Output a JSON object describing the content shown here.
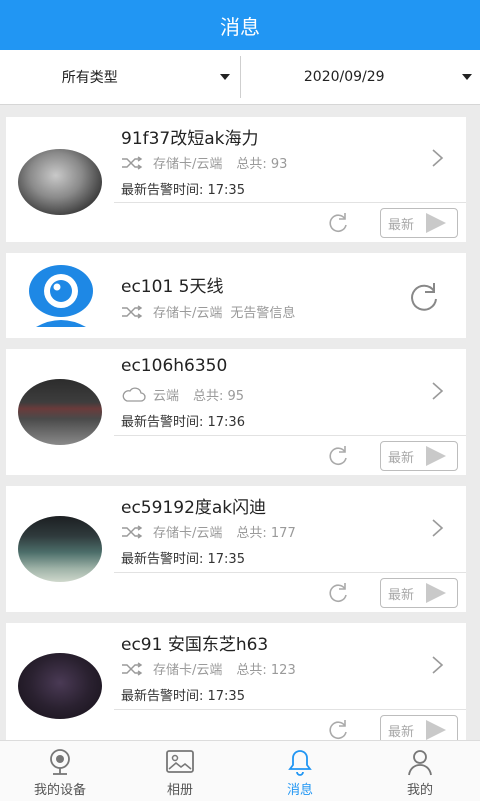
{
  "header": {
    "title": "消息"
  },
  "filters": {
    "type_label": "所有类型",
    "date_label": "2020/09/29"
  },
  "cards": [
    {
      "title": "91f37改短ak海力",
      "meta_primary": "存储卡/云端",
      "meta_secondary": "总共: 93",
      "time": "最新告警时间: 17:35",
      "new_label": "最新"
    },
    {
      "title": "ec101 5天线",
      "meta_primary": "存储卡/云端",
      "meta_secondary": "无告警信息"
    },
    {
      "title": "ec106h6350",
      "meta_primary": "云端",
      "meta_secondary": "总共: 95",
      "time": "最新告警时间: 17:36",
      "new_label": "最新"
    },
    {
      "title": "ec59192度ak闪迪",
      "meta_primary": "存储卡/云端",
      "meta_secondary": "总共: 177",
      "time": "最新告警时间: 17:35",
      "new_label": "最新"
    },
    {
      "title": "ec91 安国东芝h63",
      "meta_primary": "存储卡/云端",
      "meta_secondary": "总共: 123",
      "time": "最新告警时间: 17:35",
      "new_label": "最新"
    }
  ],
  "tabs": [
    {
      "label": "我的设备",
      "icon": "camera-icon"
    },
    {
      "label": "相册",
      "icon": "photo-icon"
    },
    {
      "label": "消息",
      "icon": "bell-icon"
    },
    {
      "label": "我的",
      "icon": "person-icon"
    }
  ],
  "colors": {
    "accent": "#2196f3",
    "background": "#ebebeb"
  }
}
